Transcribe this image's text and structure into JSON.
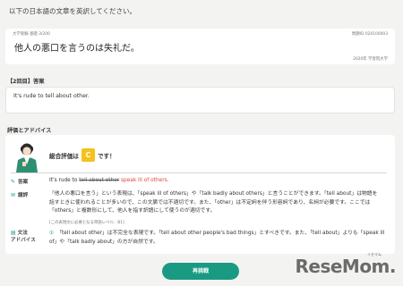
{
  "instruction": "以下の日本語の文章を英訳してください。",
  "question_card": {
    "meta_left": "大学受験 基礎  3/200",
    "meta_right": "問題ID 020100003",
    "question": "他人の悪口を言うのは失礼だ。",
    "source": "2020年 学習院大学"
  },
  "answer_section": {
    "label": "【2回目】答案",
    "answer_text": "It's rude to tell about other."
  },
  "evaluation": {
    "label": "評価とアドバイス",
    "grade_prefix": "総合評価は",
    "grade": "C",
    "grade_suffix": "です！",
    "answer_row": {
      "label": "答案",
      "prefix": "It's rude to ",
      "struck": "tell about other",
      "correction": " speak ill of others."
    },
    "explanation_row": {
      "label": "講評",
      "text": "「他人の悪口を言う」という表現は、「speak ill of others」や「talk badly about others」と言うことができます。「tell about」は物語を話すときに使われることが多いので、この文脈では不適切です。また、「other」は不定詞を伴う形容詞であり、名詞が必要です。ここでは「others」と複数形にして、他人を指す訳語にして使うのが適切です。",
      "level_note": "[この表現文に必要となる単語レベル：B1]"
    },
    "grammar_row": {
      "label_line1": "文法",
      "label_line2": "アドバイス",
      "number": "①",
      "text": "「tell about other」は不完全な表現です。「tell about other people's bad things」とすべきです。また、「tell about」よりも「speak ill of」や「talk badly about」の方が自然です。"
    }
  },
  "retry_button": "再挑戦",
  "logo": {
    "name": "ReseMom.",
    "kana": "リセマム"
  }
}
